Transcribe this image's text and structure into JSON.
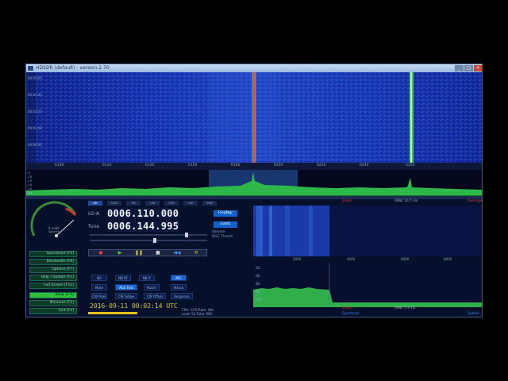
{
  "window": {
    "title": "HDSDR (default) - version 2.70",
    "minimize": "_",
    "maximize": "□",
    "close": "×"
  },
  "freq_scale": [
    "6100",
    "6120",
    "6140",
    "6160",
    "6180",
    "6200",
    "6220",
    "6240",
    "6260"
  ],
  "level_scale": [
    "-5",
    "-10",
    "-15",
    "-20",
    "-25",
    "-30"
  ],
  "modes": [
    "AM",
    "ECSS",
    "FM",
    "LSB",
    "USB",
    "CW",
    "DRM"
  ],
  "lo": {
    "label": "LO-A",
    "value": "0006.110.000"
  },
  "tune": {
    "label": "Tune",
    "value": "0006.144.995"
  },
  "side_buttons": {
    "freq_mgr": "FreqMgr",
    "extio": "ExtIO"
  },
  "side_labels": {
    "volume": "Volume",
    "thresh": "AGC Thresh"
  },
  "smeter": {
    "label": "S units",
    "sub": "Squelch",
    "scale": [
      "1",
      "3",
      "5",
      "7",
      "9",
      "+20",
      "+40"
    ]
  },
  "nav_buttons": [
    {
      "label": "Soundcard [F5]"
    },
    {
      "label": "Bandwidth [F6]"
    },
    {
      "label": "Options [F7]"
    },
    {
      "label": "Help / Update [F1]"
    },
    {
      "label": "Full Screen [F11]"
    },
    {
      "label": "Stop [F2]"
    },
    {
      "label": "Minimize [F3]"
    },
    {
      "label": "Exit [F4]"
    }
  ],
  "mode_buttons": [
    {
      "label": "NR",
      "active": false
    },
    {
      "label": "NB RF",
      "active": false
    },
    {
      "label": "NB IF",
      "active": false
    },
    {
      "label": "AFC",
      "active": true
    },
    {
      "label": "Mute",
      "active": false
    },
    {
      "label": "AGC Fast",
      "active": true
    },
    {
      "label": "Notch",
      "active": false
    },
    {
      "label": "Attack",
      "active": false
    },
    {
      "label": "CW Peak",
      "active": false
    },
    {
      "label": "CW Fullbw",
      "active": false
    },
    {
      "label": "CW Offset",
      "active": false
    },
    {
      "label": "Response",
      "active": false
    }
  ],
  "datetime": "2016-09-11   00:02:14 UTC",
  "stats": {
    "line1": "CPU: 12%   Rate: 48k",
    "line2": "Load: 54    Total: 985"
  },
  "right": {
    "top_left_label": "Zoom",
    "rbw_top": "RBW  10.5 Hz",
    "rbw_bottom": "RBW  5.9 Hz",
    "spectrum_label": "Spectrum",
    "speed_label": "Speed",
    "avg_label": "Average",
    "af_scale": [
      "2000",
      "4000",
      "6000",
      "8000"
    ],
    "af_levels": [
      "-20",
      "-40",
      "-60",
      "-80",
      "-100"
    ]
  },
  "colors": {
    "accent_blue": "#1462c8",
    "active_green": "#2fbf3a",
    "title_text": "#203050"
  }
}
